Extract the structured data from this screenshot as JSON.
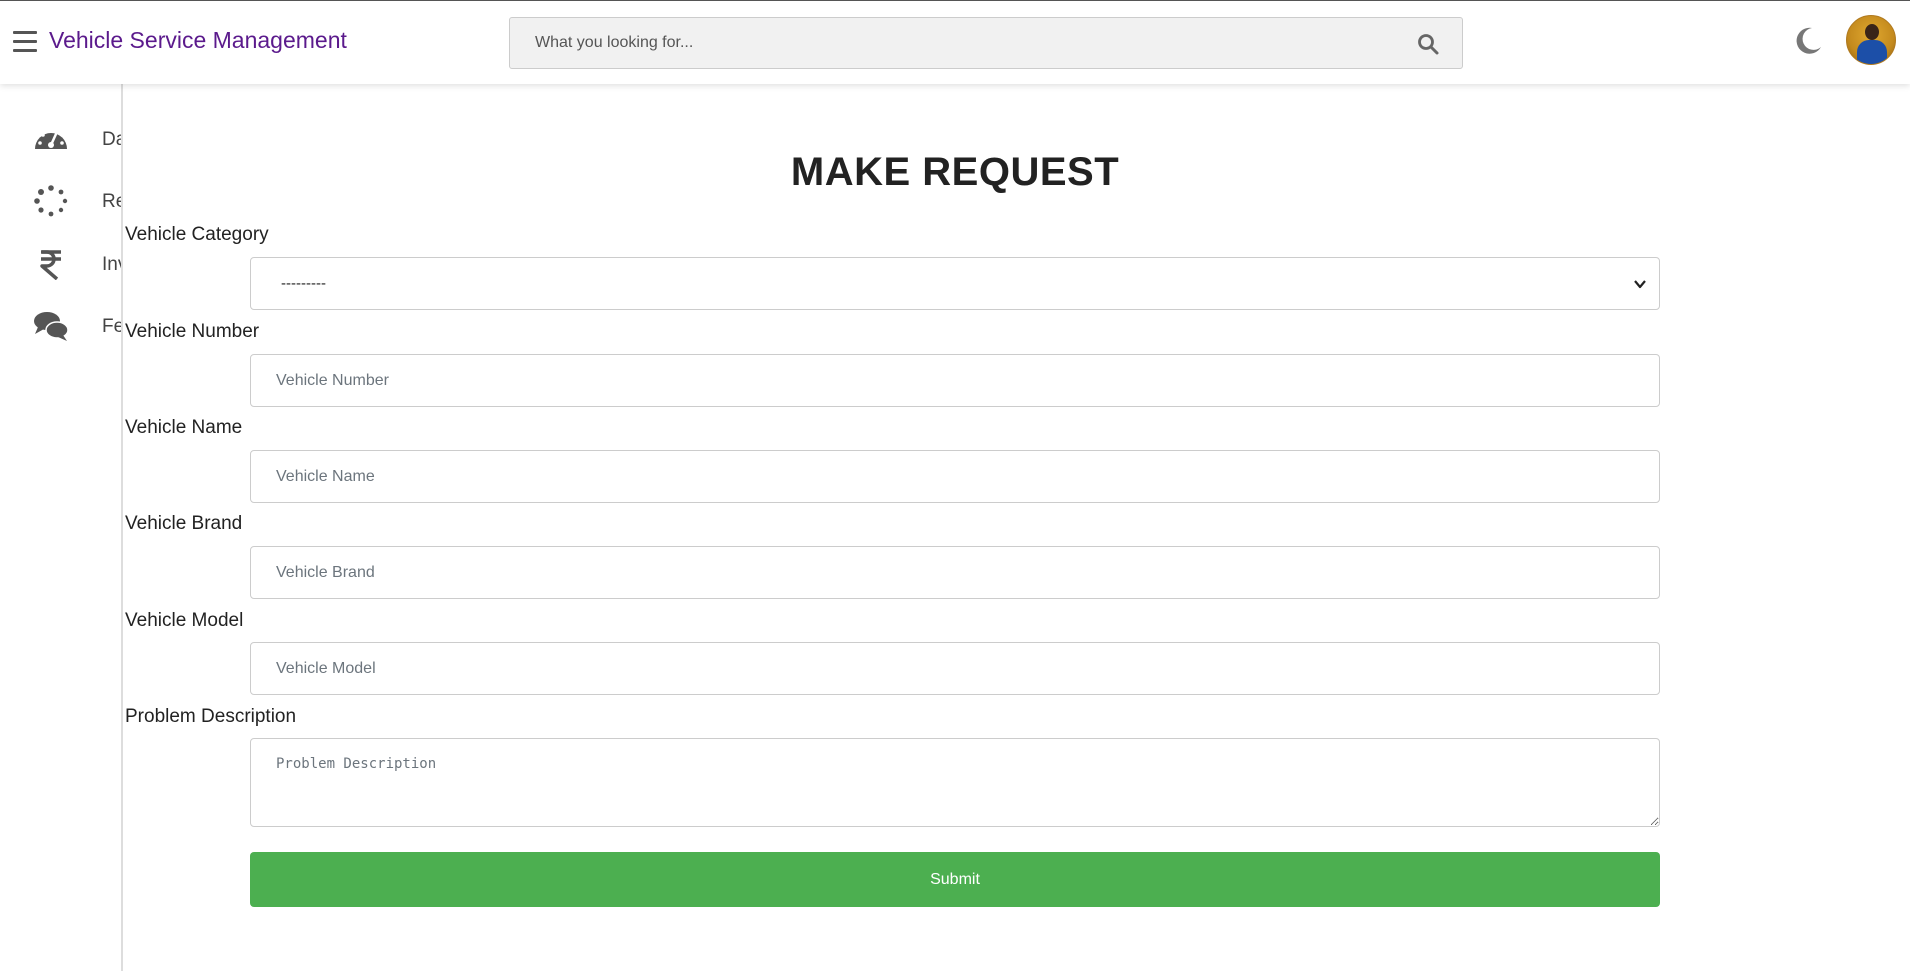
{
  "header": {
    "brand": "Vehicle Service Management",
    "search": {
      "placeholder": "What you looking for..."
    },
    "icons": {
      "menu": "hamburger-icon",
      "search": "search-icon",
      "theme": "moon-icon",
      "profile": "user-avatar"
    }
  },
  "sidebar": {
    "items": [
      {
        "label": "Dashboard",
        "icon": "tachometer-icon"
      },
      {
        "label": "Request",
        "icon": "spinner-icon"
      },
      {
        "label": "Invoice",
        "icon": "rupee-icon"
      },
      {
        "label": "Feedback",
        "icon": "comments-icon"
      }
    ]
  },
  "form": {
    "title": "MAKE REQUEST",
    "category": {
      "label": "Vehicle Category",
      "selected": "---------"
    },
    "number": {
      "label": "Vehicle Number",
      "placeholder": "Vehicle Number"
    },
    "name": {
      "label": "Vehicle Name",
      "placeholder": "Vehicle Name"
    },
    "brand": {
      "label": "Vehicle Brand",
      "placeholder": "Vehicle Brand"
    },
    "model": {
      "label": "Vehicle Model",
      "placeholder": "Vehicle Model"
    },
    "problem": {
      "label": "Problem Description",
      "placeholder": "Problem Description"
    },
    "submit_label": "Submit"
  },
  "colors": {
    "brand": "#5b1a8c",
    "submit": "#4caf50"
  }
}
